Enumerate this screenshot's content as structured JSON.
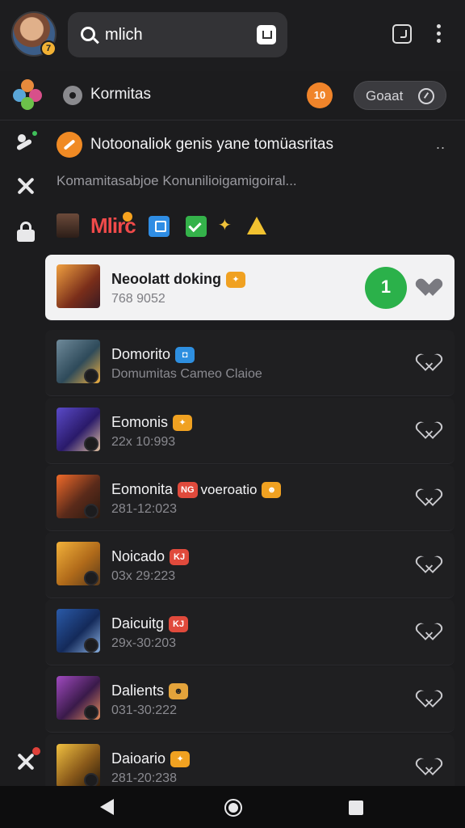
{
  "search": {
    "query": "mlich"
  },
  "header": {
    "avatar_badge": "7",
    "app_title": "Kormitas",
    "badge_label": "10",
    "goal_label": "Goaat"
  },
  "notice": {
    "title": "Notoonaliok genis yane tomüasritas",
    "more": "..",
    "subtitle": "Komamitasabjoe Konunilioigamigoiral..."
  },
  "badges": {
    "logo_text": "Mlirc"
  },
  "list": [
    {
      "title": "Neoolatt doking",
      "subtitle": "768 9052",
      "tags": [
        {
          "text": "✦",
          "color": "orange"
        }
      ],
      "note": "",
      "highlight": true,
      "action": "1"
    },
    {
      "title": "Domorito",
      "subtitle": "Domumitas Cameo Claioe",
      "tags": [
        {
          "text": "◘",
          "color": "blue"
        }
      ],
      "note": ""
    },
    {
      "title": "Eomonis",
      "subtitle": "22x 10:993",
      "tags": [
        {
          "text": "✦",
          "color": "orange"
        }
      ],
      "note": ""
    },
    {
      "title": "Eomonita",
      "subtitle": "281-12:023",
      "tags": [
        {
          "text": "NG",
          "color": "red"
        },
        {
          "text": "☻",
          "color": "orange"
        }
      ],
      "note": "voeroatio"
    },
    {
      "title": "Noicado",
      "subtitle": "03x 29:223",
      "tags": [
        {
          "text": "KJ",
          "color": "red"
        }
      ],
      "note": ""
    },
    {
      "title": "Daicuitg",
      "subtitle": "29x-30:203",
      "tags": [
        {
          "text": "KJ",
          "color": "red"
        }
      ],
      "note": ""
    },
    {
      "title": "Dalients",
      "subtitle": "031-30:222",
      "tags": [
        {
          "text": "☻",
          "color": "gold"
        }
      ],
      "note": ""
    },
    {
      "title": "Daioario",
      "subtitle": "281-20:238",
      "tags": [
        {
          "text": "✦",
          "color": "orange"
        }
      ],
      "note": ""
    }
  ],
  "colors": {
    "accent_green": "#2bb14a",
    "accent_orange": "#f0842a",
    "background": "#1c1c1e"
  }
}
